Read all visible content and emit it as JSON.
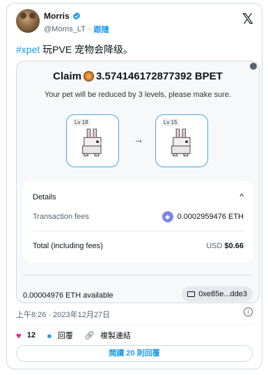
{
  "author": {
    "name": "Morris",
    "handle": "@Morris_LT",
    "follow_label": "跟隨"
  },
  "brand_logo": "𝕏",
  "tweet": {
    "hashtag": "#xpet",
    "text": " 玩PVE 宠物会降级。"
  },
  "media": {
    "claim_prefix": "Claim",
    "claim_amount": "3.574146172877392 BPET",
    "subline": "Your pet will be reduced by 3 levels, please make sure.",
    "pet_from_level": "Lv 18",
    "pet_to_level": "Lv 15",
    "arrow": "→",
    "details": {
      "title": "Details",
      "caret": "^",
      "fee_label": "Transaction fees",
      "fee_value": "0.0002959476 ETH",
      "total_label": "Total (including fees)",
      "total_currency": "USD",
      "total_amount": "$0.66"
    },
    "available": "0.00004976 ETH available",
    "address": "0xe85e...dde3"
  },
  "timestamp": "上午8:26 · 2023年12月27日",
  "actions": {
    "likes": "12",
    "reply_label": "回覆",
    "copy_link_label": "複製連結"
  },
  "read_replies_label": "閱讀 20 則回覆",
  "colors": {
    "accent": "#1d9bf0",
    "like": "#f91880",
    "text": "#0f1419",
    "muted": "#536471"
  }
}
